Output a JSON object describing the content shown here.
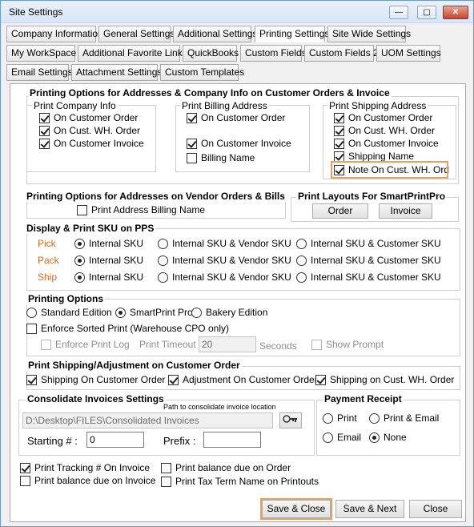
{
  "window": {
    "title": "Site Settings",
    "minimize": "—",
    "maximize": "▢",
    "close": "✕"
  },
  "tabs": {
    "row1": [
      "Company Information",
      "General Settings",
      "Additional Settings",
      "Printing Settings",
      "Site Wide Settings"
    ],
    "row2": [
      "My WorkSpace",
      "Additional Favorite Links",
      "QuickBooks",
      "Custom Fields",
      "Custom Fields 2",
      "UOM Settings"
    ],
    "row3": [
      "Email Settings",
      "Attachment Settings",
      "Custom Templates"
    ],
    "active": "Printing Settings"
  },
  "addr_customer": {
    "title": "Printing Options for Addresses & Company Info on Customer Orders & Invoice",
    "company": {
      "title": "Print Company Info",
      "items": [
        {
          "label": "On Customer Order",
          "checked": true
        },
        {
          "label": "On Cust. WH. Order",
          "checked": true
        },
        {
          "label": "On Customer Invoice",
          "checked": true
        }
      ]
    },
    "billing": {
      "title": "Print Billing Address",
      "items": [
        {
          "label": "On Customer Order",
          "checked": true
        },
        {
          "label": "On Customer Invoice",
          "checked": true
        },
        {
          "label": "Billing Name",
          "checked": false
        }
      ]
    },
    "shipping": {
      "title": "Print Shipping Address",
      "items": [
        {
          "label": "On Customer Order",
          "checked": true
        },
        {
          "label": "On Cust. WH. Order",
          "checked": true
        },
        {
          "label": "On Customer Invoice",
          "checked": true
        },
        {
          "label": "Shipping Name",
          "checked": true
        },
        {
          "label": "Note On Cust. WH. Ord",
          "checked": true
        }
      ]
    }
  },
  "vendor": {
    "title": "Printing Options for Addresses on Vendor Orders & Bills",
    "item": {
      "label": "Print Address Billing Name",
      "checked": false
    }
  },
  "layouts": {
    "title": "Print Layouts For SmartPrintPro",
    "order": "Order",
    "invoice": "Invoice"
  },
  "sku": {
    "title": "Display & Print SKU on PPS",
    "options": [
      "Internal SKU",
      "Internal SKU & Vendor SKU",
      "Internal SKU & Customer SKU"
    ],
    "rows": [
      {
        "label": "Pick",
        "selected": 0
      },
      {
        "label": "Pack",
        "selected": 0
      },
      {
        "label": "Ship",
        "selected": 0
      }
    ]
  },
  "printing": {
    "title": "Printing Options",
    "editions": [
      "Standard Edition",
      "SmartPrint Pro",
      "Bakery Edition"
    ],
    "edition_selected": 1,
    "enforce_sorted": {
      "label": "Enforce Sorted Print (Warehouse CPO only)",
      "checked": false
    },
    "enforce_log": {
      "label": "Enforce Print Log",
      "checked": false
    },
    "timeout_label": "Print Timeout :",
    "timeout_value": "20",
    "seconds": "Seconds",
    "show_prompt": {
      "label": "Show Prompt",
      "checked": false
    }
  },
  "shipadj": {
    "title": "Print Shipping/Adjustment on Customer Order",
    "items": [
      {
        "label": "Shipping On Customer Order",
        "checked": true
      },
      {
        "label": "Adjustment On Customer Order",
        "checked": true
      },
      {
        "label": "Shipping on Cust. WH. Order",
        "checked": true
      }
    ]
  },
  "consolidate": {
    "title": "Consolidate Invoices Settings",
    "path_label": "Path to consolidate invoice location",
    "path_value": "D:\\Desktop\\FILES\\Consolidated Invoices",
    "starting_label": "Starting # :",
    "starting_value": "0",
    "prefix_label": "Prefix :",
    "prefix_value": ""
  },
  "payment": {
    "title": "Payment Receipt",
    "options": [
      "Print",
      "Print & Email",
      "Email",
      "None"
    ],
    "selected": 3
  },
  "misc": {
    "items": [
      {
        "label": "Print Tracking # On Invoice",
        "checked": true
      },
      {
        "label": "Print balance due on Order",
        "checked": false
      },
      {
        "label": "Print balance due on Invoice",
        "checked": false
      },
      {
        "label": "Print Tax Term Name on Printouts",
        "checked": false
      }
    ]
  },
  "footer": {
    "save_close": "Save & Close",
    "save_next": "Save & Next",
    "close": "Close"
  },
  "colors": {
    "accent": "#e8a060",
    "row_label": "#d2691e"
  }
}
